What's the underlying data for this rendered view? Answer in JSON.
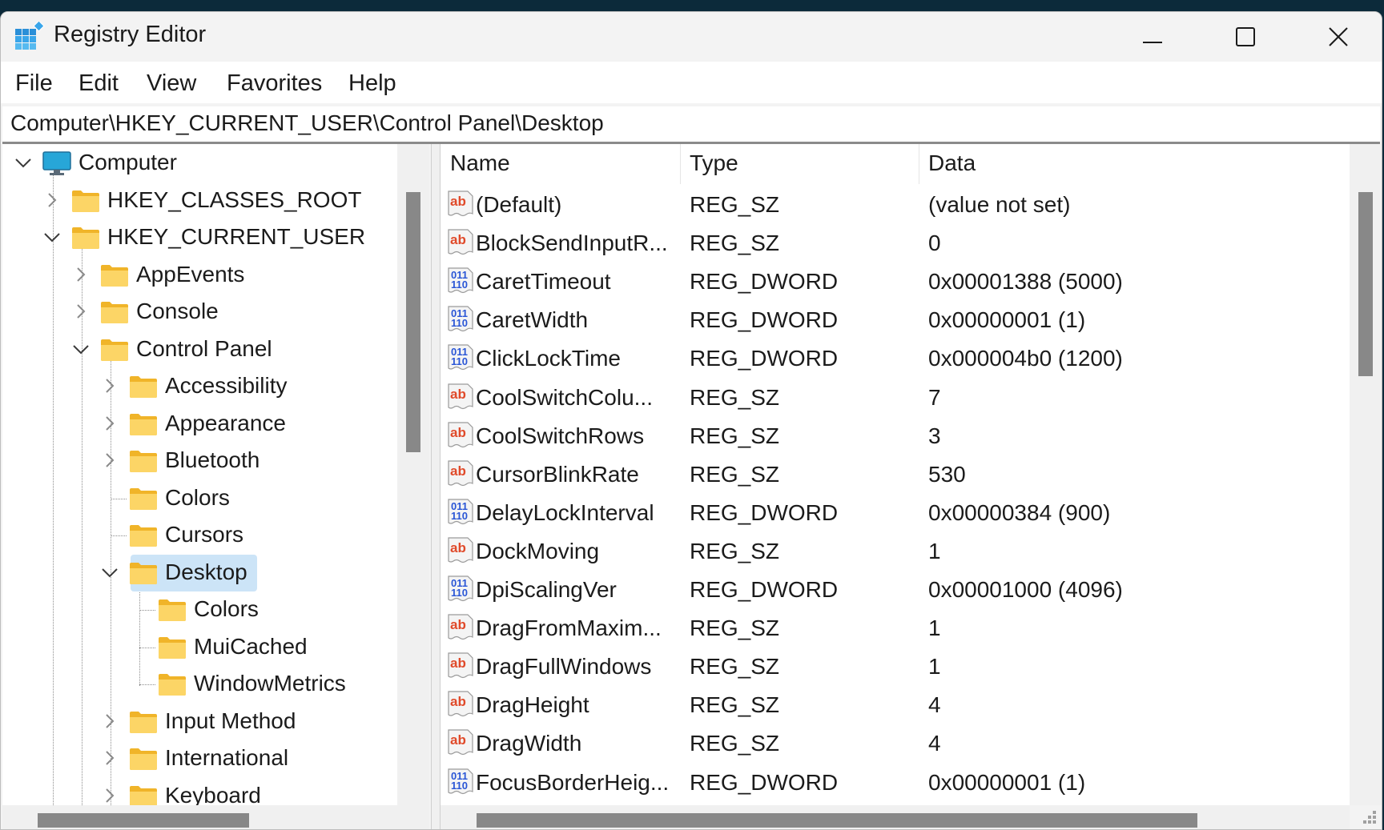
{
  "window": {
    "title": "Registry Editor",
    "controls": {
      "minimize": "minimize",
      "maximize": "maximize",
      "close": "close"
    }
  },
  "menu": [
    "File",
    "Edit",
    "View",
    "Favorites",
    "Help"
  ],
  "address": "Computer\\HKEY_CURRENT_USER\\Control Panel\\Desktop",
  "tree": [
    {
      "label": "Computer",
      "level": 0,
      "expander": "expanded",
      "icon": "computer-icon"
    },
    {
      "label": "HKEY_CLASSES_ROOT",
      "level": 1,
      "expander": "collapsed",
      "icon": "folder-icon"
    },
    {
      "label": "HKEY_CURRENT_USER",
      "level": 1,
      "expander": "expanded",
      "icon": "folder-icon"
    },
    {
      "label": "AppEvents",
      "level": 2,
      "expander": "collapsed",
      "icon": "folder-icon"
    },
    {
      "label": "Console",
      "level": 2,
      "expander": "collapsed",
      "icon": "folder-icon"
    },
    {
      "label": "Control Panel",
      "level": 2,
      "expander": "expanded",
      "icon": "folder-icon"
    },
    {
      "label": "Accessibility",
      "level": 3,
      "expander": "collapsed",
      "icon": "folder-icon"
    },
    {
      "label": "Appearance",
      "level": 3,
      "expander": "collapsed",
      "icon": "folder-icon"
    },
    {
      "label": "Bluetooth",
      "level": 3,
      "expander": "collapsed",
      "icon": "folder-icon"
    },
    {
      "label": "Colors",
      "level": 3,
      "expander": "none",
      "icon": "folder-icon"
    },
    {
      "label": "Cursors",
      "level": 3,
      "expander": "none",
      "icon": "folder-icon"
    },
    {
      "label": "Desktop",
      "level": 3,
      "expander": "expanded",
      "icon": "folder-icon",
      "selected": true
    },
    {
      "label": "Colors",
      "level": 4,
      "expander": "none",
      "icon": "folder-icon"
    },
    {
      "label": "MuiCached",
      "level": 4,
      "expander": "none",
      "icon": "folder-icon"
    },
    {
      "label": "WindowMetrics",
      "level": 4,
      "expander": "none",
      "icon": "folder-icon"
    },
    {
      "label": "Input Method",
      "level": 3,
      "expander": "collapsed",
      "icon": "folder-icon"
    },
    {
      "label": "International",
      "level": 3,
      "expander": "collapsed",
      "icon": "folder-icon"
    },
    {
      "label": "Keyboard",
      "level": 3,
      "expander": "collapsed",
      "icon": "folder-icon"
    }
  ],
  "list": {
    "columns": [
      "Name",
      "Type",
      "Data"
    ],
    "rows": [
      {
        "name": "(Default)",
        "type": "REG_SZ",
        "data": "(value not set)",
        "icon": "string"
      },
      {
        "name": "BlockSendInputR...",
        "type": "REG_SZ",
        "data": "0",
        "icon": "string"
      },
      {
        "name": "CaretTimeout",
        "type": "REG_DWORD",
        "data": "0x00001388 (5000)",
        "icon": "binary"
      },
      {
        "name": "CaretWidth",
        "type": "REG_DWORD",
        "data": "0x00000001 (1)",
        "icon": "binary"
      },
      {
        "name": "ClickLockTime",
        "type": "REG_DWORD",
        "data": "0x000004b0 (1200)",
        "icon": "binary"
      },
      {
        "name": "CoolSwitchColu...",
        "type": "REG_SZ",
        "data": "7",
        "icon": "string"
      },
      {
        "name": "CoolSwitchRows",
        "type": "REG_SZ",
        "data": "3",
        "icon": "string"
      },
      {
        "name": "CursorBlinkRate",
        "type": "REG_SZ",
        "data": "530",
        "icon": "string"
      },
      {
        "name": "DelayLockInterval",
        "type": "REG_DWORD",
        "data": "0x00000384 (900)",
        "icon": "binary"
      },
      {
        "name": "DockMoving",
        "type": "REG_SZ",
        "data": "1",
        "icon": "string"
      },
      {
        "name": "DpiScalingVer",
        "type": "REG_DWORD",
        "data": "0x00001000 (4096)",
        "icon": "binary"
      },
      {
        "name": "DragFromMaxim...",
        "type": "REG_SZ",
        "data": "1",
        "icon": "string"
      },
      {
        "name": "DragFullWindows",
        "type": "REG_SZ",
        "data": "1",
        "icon": "string"
      },
      {
        "name": "DragHeight",
        "type": "REG_SZ",
        "data": "4",
        "icon": "string"
      },
      {
        "name": "DragWidth",
        "type": "REG_SZ",
        "data": "4",
        "icon": "string"
      },
      {
        "name": "FocusBorderHeig...",
        "type": "REG_DWORD",
        "data": "0x00000001 (1)",
        "icon": "binary"
      }
    ]
  },
  "colors": {
    "selection": "#cce4f7",
    "string_icon": "#e04a2a",
    "binary_icon": "#2a56d6",
    "folder": "#f8c94a",
    "scroll_thumb": "#888888"
  }
}
